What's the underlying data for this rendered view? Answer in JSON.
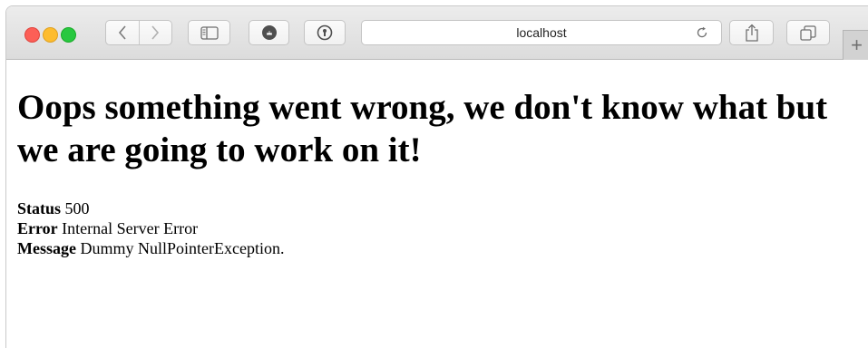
{
  "browser": {
    "address_bar": {
      "url": "localhost"
    },
    "new_tab_label": "+"
  },
  "page": {
    "heading": "Oops something went wrong, we don't know what but we are going to work on it!",
    "fields": [
      {
        "label": "Status",
        "value": "500"
      },
      {
        "label": "Error",
        "value": "Internal Server Error"
      },
      {
        "label": "Message",
        "value": "Dummy NullPointerException."
      }
    ]
  }
}
